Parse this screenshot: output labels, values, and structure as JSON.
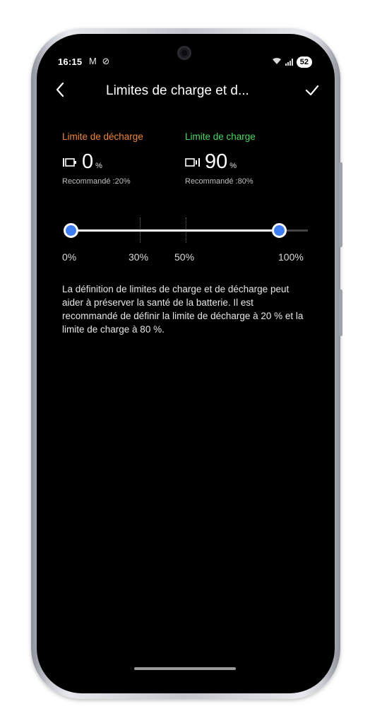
{
  "status_bar": {
    "time": "16:15",
    "left_icons": "M ⊘",
    "battery": "52"
  },
  "header": {
    "title": "Limites de charge et d..."
  },
  "discharge": {
    "label": "Limite de décharge",
    "value": "0",
    "unit": "%",
    "recommended": "Recommandé :20%",
    "color": "#f0863a"
  },
  "charge": {
    "label": "Limite de charge",
    "value": "90",
    "unit": "%",
    "recommended": "Recommandé :80%",
    "color": "#4cd964"
  },
  "slider": {
    "min_value": 0,
    "max_value": 90,
    "accent_color": "#3d7cf2",
    "ticks": [
      "0%",
      "30%",
      "50%",
      "100%"
    ]
  },
  "description": "La définition de limites de charge et de décharge peut aider à préserver la santé de la batterie. Il est recommandé de définir la limite de décharge à 20 % et la limite de charge à 80 %."
}
